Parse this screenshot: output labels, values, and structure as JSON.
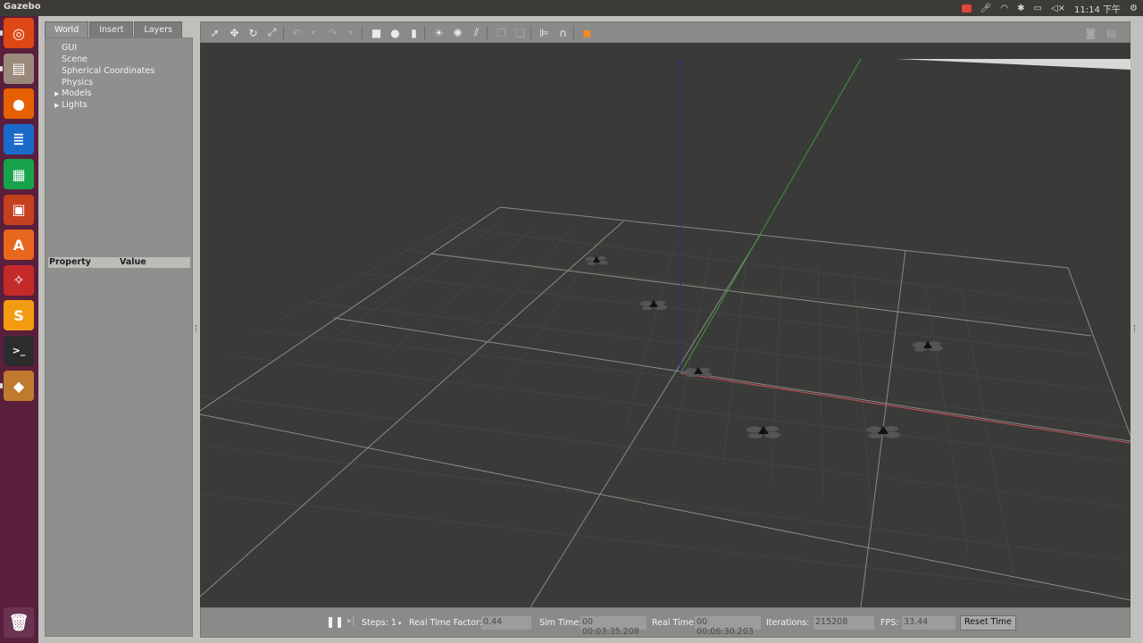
{
  "system_bar": {
    "app_title": "Gazebo",
    "clock": "11:14 下午",
    "tray_icons": [
      "record-icon",
      "sound-input-icon",
      "network-wifi-icon",
      "bluetooth-icon",
      "battery-icon",
      "volume-icon",
      "settings-gear-icon"
    ]
  },
  "launcher": {
    "items": [
      {
        "name": "ubuntu-home-icon",
        "glyph": "◎",
        "color": "#dd4814"
      },
      {
        "name": "files-icon",
        "glyph": "▤",
        "color": "#9b8a7b"
      },
      {
        "name": "firefox-icon",
        "glyph": "●",
        "color": "#e66000"
      },
      {
        "name": "writer-icon",
        "glyph": "≣",
        "color": "#1b6ac9"
      },
      {
        "name": "calc-icon",
        "glyph": "▦",
        "color": "#17a34a"
      },
      {
        "name": "impress-icon",
        "glyph": "▣",
        "color": "#c4401f"
      },
      {
        "name": "software-center-icon",
        "glyph": "A",
        "color": "#e8661d"
      },
      {
        "name": "settings-tools-icon",
        "glyph": "✧",
        "color": "#c42a2a"
      },
      {
        "name": "sublime-text-icon",
        "glyph": "S",
        "color": "#f39c12"
      },
      {
        "name": "terminal-icon",
        "glyph": ">_",
        "color": "#2c2c2c"
      },
      {
        "name": "gazebo-icon",
        "glyph": "◆",
        "color": "#c07a2d"
      }
    ],
    "trash": {
      "name": "trash-icon",
      "glyph": "🗑"
    }
  },
  "left_panel": {
    "tabs": [
      "World",
      "Insert",
      "Layers"
    ],
    "tree": [
      {
        "label": "GUI",
        "expandable": false
      },
      {
        "label": "Scene",
        "expandable": false
      },
      {
        "label": "Spherical Coordinates",
        "expandable": false
      },
      {
        "label": "Physics",
        "expandable": false
      },
      {
        "label": "Models",
        "expandable": true
      },
      {
        "label": "Lights",
        "expandable": true
      }
    ],
    "property_header": {
      "property": "Property",
      "value": "Value"
    }
  },
  "toolbar": {
    "tools": [
      "select-arrow-icon",
      "translate-icon",
      "rotate-icon",
      "scale-icon",
      "undo-icon",
      "undo-dropdown-icon",
      "redo-icon",
      "redo-dropdown-icon",
      "box-shape-icon",
      "sphere-shape-icon",
      "cylinder-shape-icon",
      "point-light-icon",
      "spot-light-icon",
      "directional-light-icon",
      "copy-icon",
      "paste-icon",
      "align-icon",
      "snap-icon",
      "view-angle-icon"
    ],
    "right_tools": [
      "screenshot-icon",
      "record-log-icon"
    ]
  },
  "bottom_bar": {
    "steps_label": "Steps:",
    "steps_value": "1",
    "rtf_label": "Real Time Factor:",
    "rtf_value": "0.44",
    "sim_time_label": "Sim Time:",
    "sim_time_value": "00 00:03:35.208",
    "real_time_label": "Real Time:",
    "real_time_value": "00 00:06:30.203",
    "iterations_label": "Iterations:",
    "iterations_value": "215208",
    "fps_label": "FPS:",
    "fps_value": "33.44",
    "reset_label": "Reset Time"
  },
  "colors": {
    "viewport_bg": "#3a3a38",
    "grid_line": "#8a8a87",
    "axis_x": "#c0505a",
    "axis_y": "#3a9a3a",
    "axis_z": "#2a2aa0",
    "launcher_bg": "#5a1f3d"
  },
  "scene": {
    "models": [
      "drone-model",
      "drone-model",
      "drone-model",
      "drone-model",
      "drone-model",
      "drone-model"
    ]
  }
}
